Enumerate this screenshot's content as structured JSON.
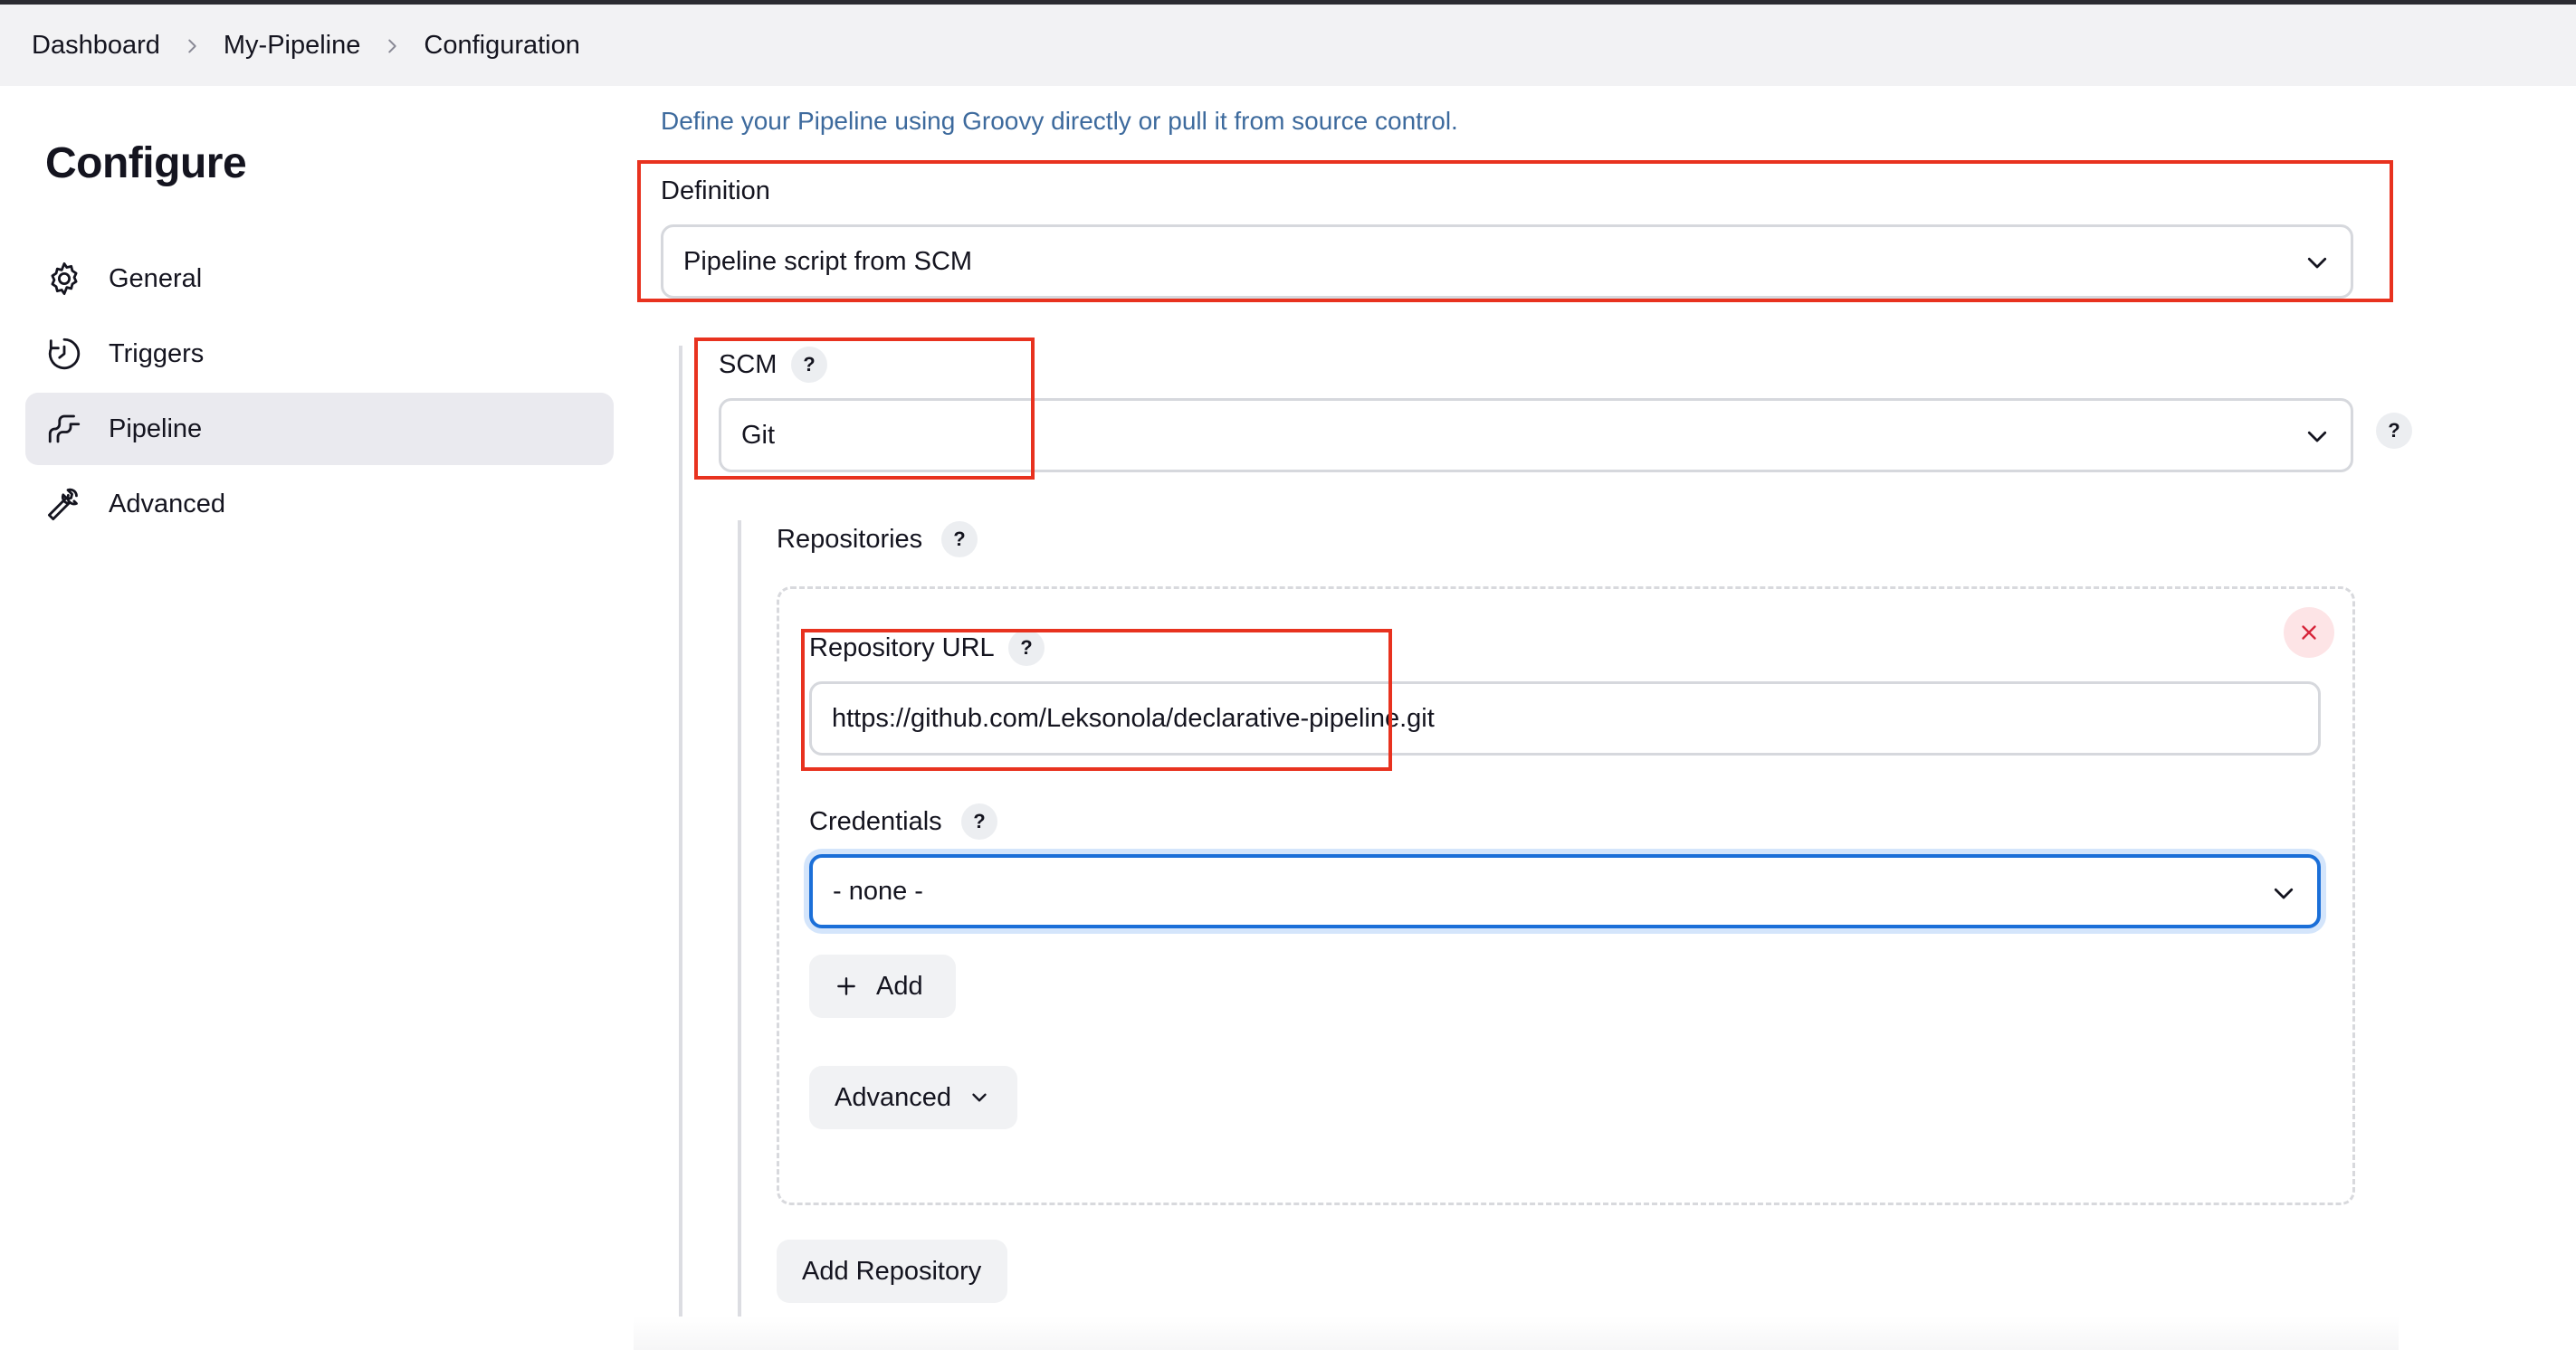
{
  "breadcrumb": {
    "items": [
      "Dashboard",
      "My-Pipeline",
      "Configuration"
    ]
  },
  "sidebar": {
    "title": "Configure",
    "items": [
      {
        "label": "General",
        "icon": "gear-icon"
      },
      {
        "label": "Triggers",
        "icon": "clock-icon"
      },
      {
        "label": "Pipeline",
        "icon": "pipeline-icon",
        "active": true
      },
      {
        "label": "Advanced",
        "icon": "wrench-icon"
      }
    ]
  },
  "pipeline": {
    "description": "Define your Pipeline using Groovy directly or pull it from source control.",
    "definition": {
      "label": "Definition",
      "value": "Pipeline script from SCM"
    },
    "scm": {
      "label": "SCM",
      "value": "Git"
    },
    "repositories": {
      "label": "Repositories",
      "repository_url": {
        "label": "Repository URL",
        "value": "https://github.com/Leksonola/declarative-pipeline.git"
      },
      "credentials": {
        "label": "Credentials",
        "value": "- none -"
      },
      "add_label": "Add",
      "advanced_label": "Advanced",
      "add_repository_label": "Add Repository"
    },
    "help_symbol": "?"
  },
  "colors": {
    "annotation": "#e8321f",
    "link_text": "#3d6a9d",
    "focus": "#1b6fd8",
    "active_nav": "#eaeaef"
  }
}
